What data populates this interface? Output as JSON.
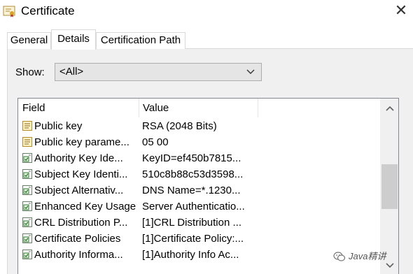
{
  "window": {
    "title": "Certificate",
    "close_glyph": "✕"
  },
  "tabs": [
    {
      "label": "General",
      "active": false
    },
    {
      "label": "Details",
      "active": true
    },
    {
      "label": "Certification Path",
      "active": false
    }
  ],
  "show": {
    "label": "Show:",
    "selected": "<All>"
  },
  "list": {
    "columns": [
      "Field",
      "Value"
    ],
    "rows": [
      {
        "icon": "property-icon",
        "field": "Public key",
        "value": "RSA (2048 Bits)"
      },
      {
        "icon": "property-icon",
        "field": "Public key parame...",
        "value": "05 00"
      },
      {
        "icon": "extension-icon",
        "field": "Authority Key Ide...",
        "value": "KeyID=ef450b7815..."
      },
      {
        "icon": "extension-icon",
        "field": "Subject Key Identi...",
        "value": "510c8b88c53d3598..."
      },
      {
        "icon": "extension-icon",
        "field": "Subject Alternativ...",
        "value": "DNS Name=*.1230..."
      },
      {
        "icon": "extension-icon",
        "field": "Enhanced Key Usage",
        "value": "Server Authenticatio..."
      },
      {
        "icon": "extension-icon",
        "field": "CRL Distribution P...",
        "value": "[1]CRL Distribution ..."
      },
      {
        "icon": "extension-icon",
        "field": "Certificate Policies",
        "value": "[1]Certificate Policy:..."
      },
      {
        "icon": "extension-icon",
        "field": "Authority Informa...",
        "value": "[1]Authority Info Ac..."
      }
    ]
  },
  "watermark": {
    "text": "Java精讲"
  }
}
